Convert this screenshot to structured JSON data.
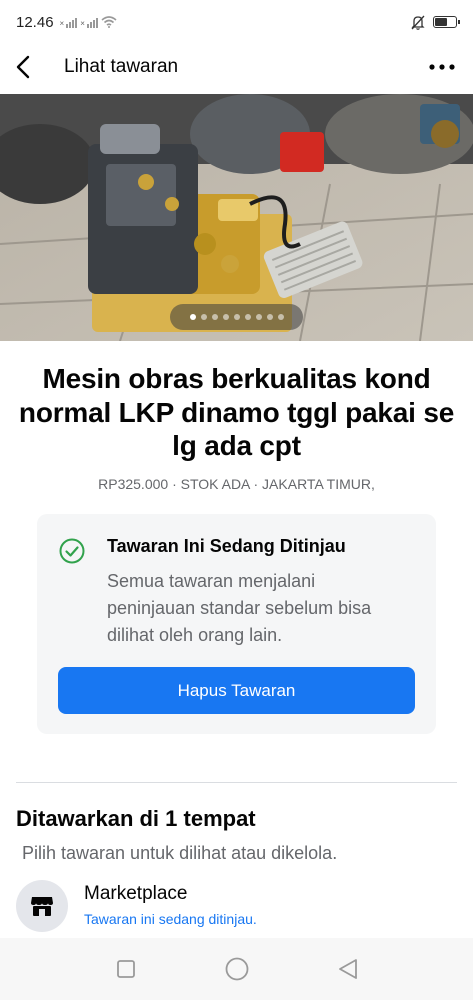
{
  "status_bar": {
    "time": "12.46",
    "icons": [
      "signal-1-icon",
      "signal-2-icon",
      "wifi-icon",
      "mute-icon",
      "battery-icon"
    ]
  },
  "header": {
    "title": "Lihat tawaran",
    "back_icon": "back-arrow-icon",
    "more_icon": "more-dots-icon"
  },
  "listing": {
    "photo": {
      "description_icon": "product-photo",
      "slide_count": 9,
      "active_slide": 1
    },
    "title": "Mesin obras berkualitas kond normal LKP dinamo tggl pakai se lg ada cpt",
    "subtitle": "RP325.000 · STOK ADA · JAKARTA TIMUR,"
  },
  "review_notice": {
    "icon": "check-circle-icon",
    "title": "Tawaran Ini Sedang Ditinjau",
    "description": "Semua tawaran menjalani peninjauan standar sebelum bisa dilihat oleh orang lain.",
    "button_label": "Hapus Tawaran"
  },
  "offered_section": {
    "title": "Ditawarkan di 1 tempat",
    "subtitle": "Pilih tawaran untuk dilihat atau dikelola.",
    "places": [
      {
        "name": "Marketplace",
        "status": "Tawaran ini sedang ditinjau.",
        "icon": "marketplace-shop-icon"
      }
    ]
  },
  "nav_bar": {
    "icons": [
      "recent-apps-icon",
      "home-icon",
      "back-icon"
    ]
  },
  "colors": {
    "accent": "#1877f2",
    "success_green": "#31a24c",
    "secondary_text": "#65676b",
    "card_bg": "#f5f6f7"
  }
}
